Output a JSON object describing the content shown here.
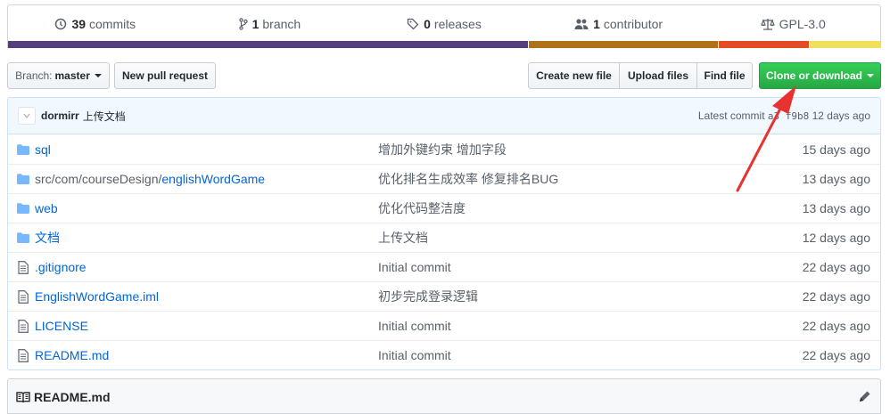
{
  "summary": {
    "commits": {
      "count": "39",
      "label": "commits"
    },
    "branches": {
      "count": "1",
      "label": "branch"
    },
    "releases": {
      "count": "0",
      "label": "releases"
    },
    "contributors": {
      "count": "1",
      "label": "contributor"
    },
    "license": {
      "label": "GPL-3.0"
    }
  },
  "language_bar": [
    {
      "color": "#563d7c",
      "fraction": 0.597
    },
    {
      "color": "#b07219",
      "fraction": 0.218
    },
    {
      "color": "#e34c26",
      "fraction": 0.104
    },
    {
      "color": "#f1e05a",
      "fraction": 0.081
    }
  ],
  "toolbar": {
    "branch_prefix": "Branch:",
    "branch_name": "master",
    "new_pr": "New pull request",
    "create_file": "Create new file",
    "upload_files": "Upload files",
    "find_file": "Find file",
    "clone": "Clone or download"
  },
  "commit_tease": {
    "author": "dormirr",
    "message": "上传文档",
    "latest_label": "Latest commit",
    "sha": "a3 f9b8",
    "age": "12 days ago"
  },
  "files": [
    {
      "type": "dir",
      "name": "sql",
      "prefix": "",
      "message": "增加外键约束 增加字段",
      "age": "15 days ago"
    },
    {
      "type": "dir",
      "name": "englishWordGame",
      "prefix": "src/com/courseDesign/",
      "message": "优化排名生成效率 修复排名BUG",
      "age": "13 days ago"
    },
    {
      "type": "dir",
      "name": "web",
      "prefix": "",
      "message": "优化代码整洁度",
      "age": "13 days ago"
    },
    {
      "type": "dir",
      "name": "文档",
      "prefix": "",
      "message": "上传文档",
      "age": "12 days ago"
    },
    {
      "type": "file",
      "name": ".gitignore",
      "prefix": "",
      "message": "Initial commit",
      "age": "22 days ago"
    },
    {
      "type": "file",
      "name": "EnglishWordGame.iml",
      "prefix": "",
      "message": "初步完成登录逻辑",
      "age": "22 days ago"
    },
    {
      "type": "file",
      "name": "LICENSE",
      "prefix": "",
      "message": "Initial commit",
      "age": "22 days ago"
    },
    {
      "type": "file",
      "name": "README.md",
      "prefix": "",
      "message": "Initial commit",
      "age": "22 days ago"
    }
  ],
  "readme": {
    "title": "README.md"
  },
  "colors": {
    "accent_link": "#0366d6",
    "clone_green": "#28a745",
    "annotation_arrow": "#e8322f"
  }
}
